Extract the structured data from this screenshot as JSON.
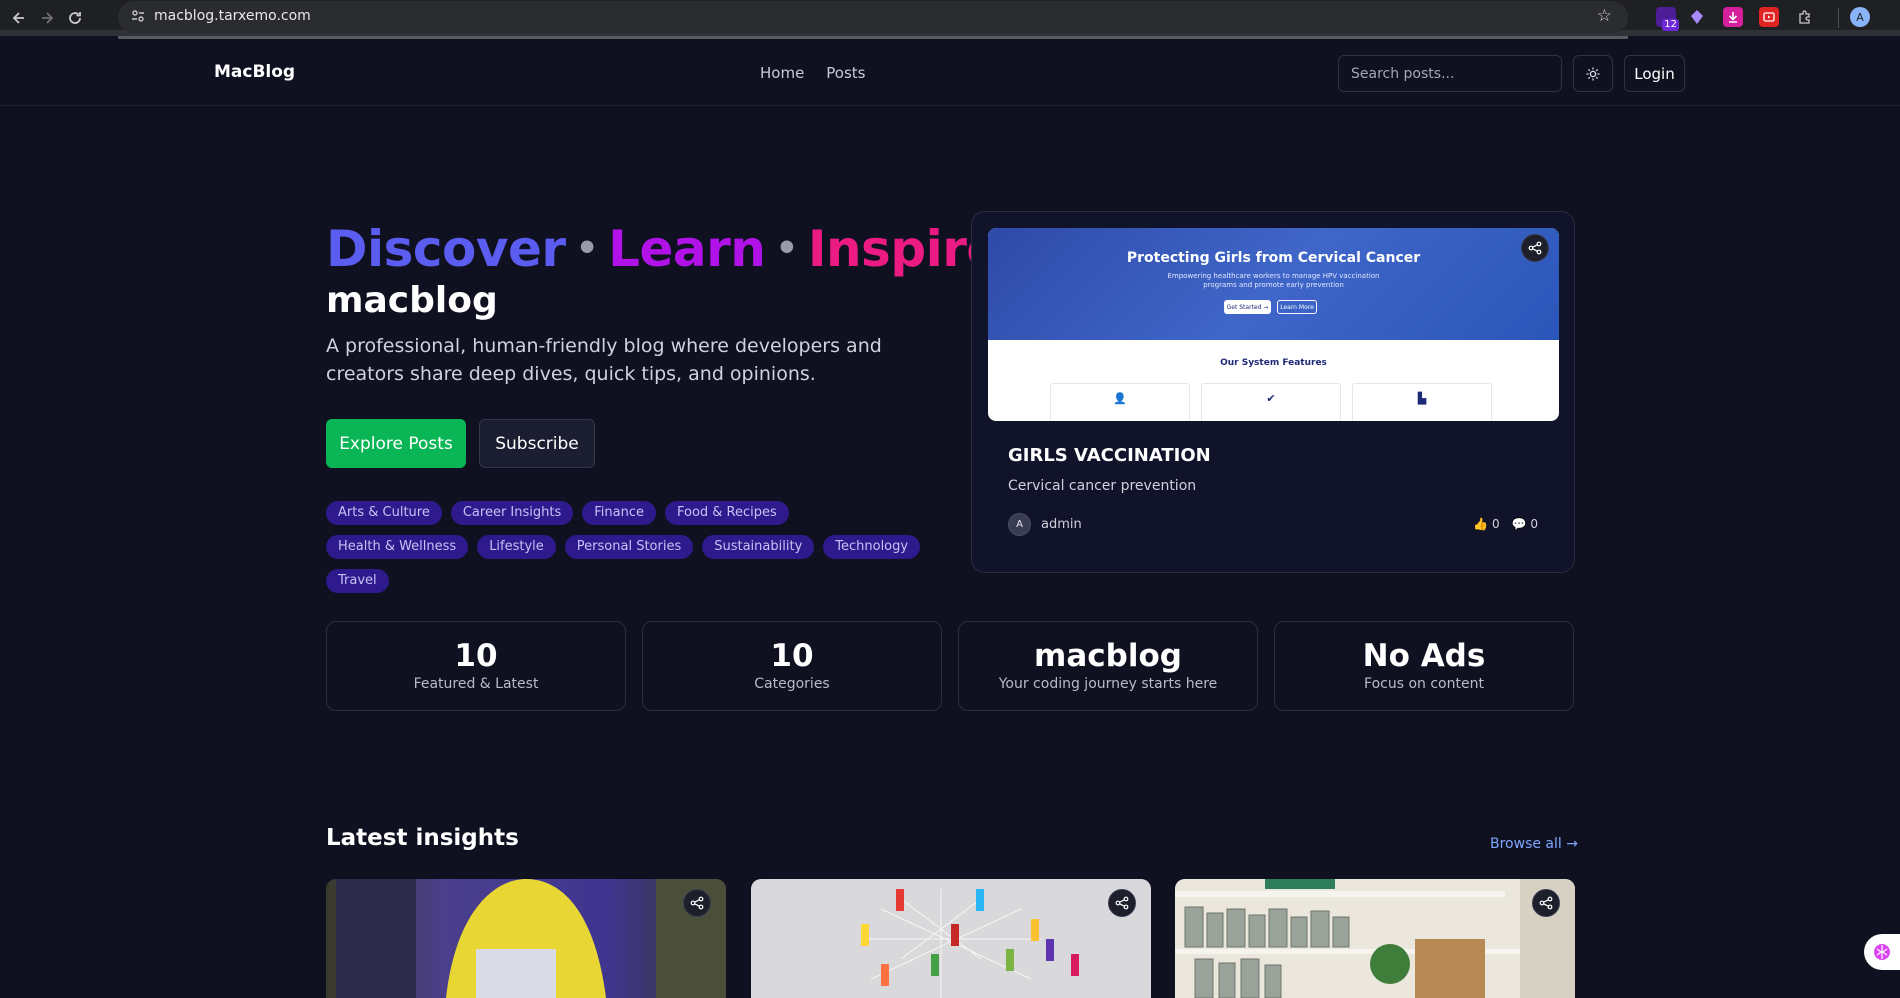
{
  "browser": {
    "url": "macblog.tarxemo.com",
    "ext_badge": "12",
    "profile_initial": "A"
  },
  "header": {
    "brand": "MacBlog",
    "nav": [
      "Home",
      "Posts"
    ],
    "search_placeholder": "Search posts...",
    "login_label": "Login"
  },
  "hero": {
    "words": [
      "Discover",
      "Learn",
      "Inspire"
    ],
    "separator": "•",
    "subtitle": "macblog",
    "description": "A professional, human-friendly blog where developers and creators share deep dives, quick tips, and opinions.",
    "primary_cta": "Explore Posts",
    "secondary_cta": "Subscribe",
    "tags": [
      "Arts & Culture",
      "Career Insights",
      "Finance",
      "Food & Recipes",
      "Health & Wellness",
      "Lifestyle",
      "Personal Stories",
      "Sustainability",
      "Technology",
      "Travel"
    ]
  },
  "featured": {
    "image": {
      "banner_title": "Protecting Girls from Cervical Cancer",
      "banner_text": "Empowering healthcare workers to manage HPV vaccination programs and promote early prevention",
      "btn_start": "Get Started →",
      "btn_learn": "Learn More",
      "features_heading": "Our System Features"
    },
    "title": "GIRLS VACCINATION",
    "description": "Cervical cancer prevention",
    "author_initial": "A",
    "author": "admin",
    "likes": "0",
    "comments": "0"
  },
  "stats": [
    {
      "value": "10",
      "label": "Featured & Latest"
    },
    {
      "value": "10",
      "label": "Categories"
    },
    {
      "value": "macblog",
      "label": "Your coding journey starts here"
    },
    {
      "value": "No Ads",
      "label": "Focus on content"
    }
  ],
  "latest": {
    "title": "Latest insights",
    "browse_all": "Browse all →"
  },
  "colors": {
    "background": "#0f1020",
    "discover": "#5b5cf0",
    "learn": "#b012e8",
    "inspire": "#ec1b83",
    "primary": "#0ab556",
    "tag_bg": "#2e1a8c",
    "link": "#7fa6ff"
  }
}
